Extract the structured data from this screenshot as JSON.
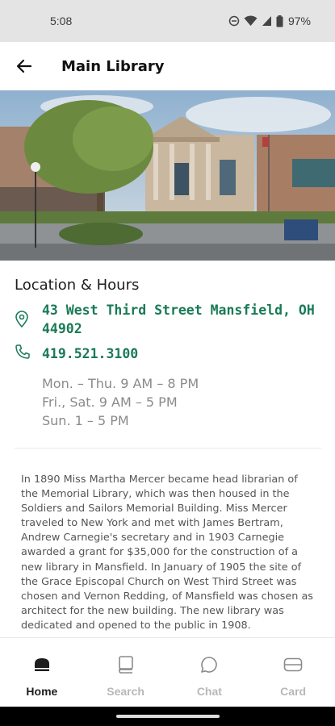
{
  "status_bar": {
    "time": "5:08",
    "battery": "97%"
  },
  "app_bar": {
    "title": "Main Library"
  },
  "location": {
    "section_title": "Location & Hours",
    "address": "43 West Third Street Mansfield, OH 44902",
    "phone": "419.521.3100",
    "hours": [
      "Mon. – Thu. 9 AM – 8 PM",
      "Fri., Sat. 9 AM – 5 PM",
      "Sun. 1 – 5 PM"
    ],
    "accent_color": "#1a7a56"
  },
  "description": "In 1890 Miss Martha Mercer became head librarian of the Memorial Library, which was then housed in the Soldiers and Sailors Memorial Building. Miss Mercer traveled to New York and met with James Bertram, Andrew Carnegie's secretary and in 1903 Carnegie awarded a grant for $35,000 for the construction of a new library in Mansfield. In January of 1905 the site of the Grace Episcopal Church on West Third Street was chosen and Vernon Redding, of Mansfield was chosen as architect for the new building. The new library was dedicated and opened to the public in 1908.",
  "bottom_nav": [
    {
      "label": "Home",
      "icon": "home-icon",
      "active": true
    },
    {
      "label": "Search",
      "icon": "book-icon",
      "active": false
    },
    {
      "label": "Chat",
      "icon": "chat-bubble-icon",
      "active": false
    },
    {
      "label": "Card",
      "icon": "card-icon",
      "active": false
    }
  ]
}
